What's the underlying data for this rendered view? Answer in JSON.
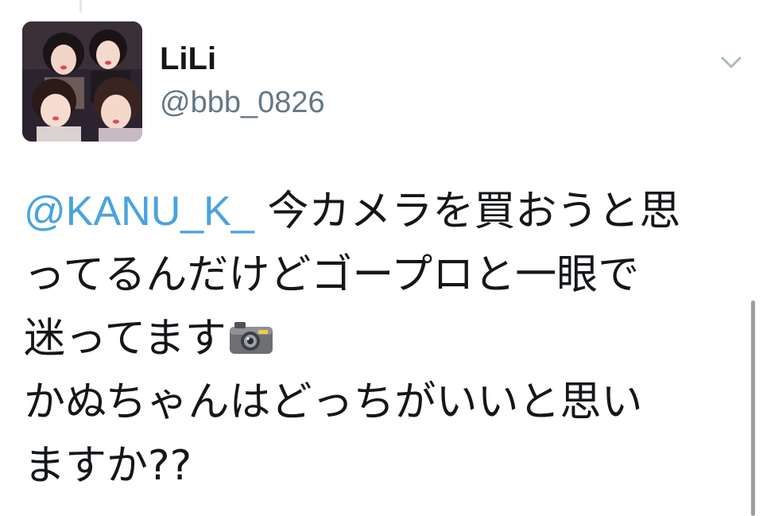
{
  "tweet": {
    "author": {
      "display_name": "LiLi",
      "handle": "@bbb_0826"
    },
    "mention": "@KANU_K_",
    "lines": [
      " 今カメラを買おうと思",
      "ってるんだけどゴープロと一眼で",
      "迷ってます",
      "かぬちゃんはどっちがいいと思い",
      "ますか??"
    ],
    "emoji": "camera-emoji",
    "menu_icon": "chevron-down-icon"
  },
  "colors": {
    "mention": "#4aa3df",
    "handle": "#657786",
    "text": "#14171a"
  }
}
